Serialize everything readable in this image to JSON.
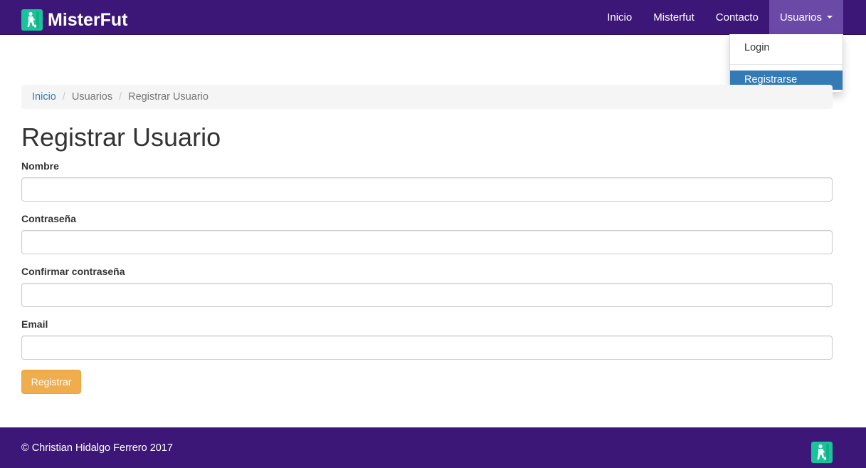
{
  "colors": {
    "brand": "#3d1778",
    "logo_accent": "#18c59a",
    "link": "#337ab7",
    "warning_button": "#f0ad4e"
  },
  "navbar": {
    "brand_name": "MisterFut",
    "brand_icon": "player-logo-icon",
    "items": [
      {
        "label": "Inicio"
      },
      {
        "label": "Misterfut"
      },
      {
        "label": "Contacto"
      },
      {
        "label": "Usuarios"
      }
    ]
  },
  "dropdown": {
    "items": [
      {
        "label": "Login"
      },
      {
        "label": "Registrarse"
      }
    ],
    "selected": "Registrarse"
  },
  "breadcrumb": {
    "items": [
      "Inicio",
      "Usuarios",
      "Registrar Usuario"
    ]
  },
  "page": {
    "title": "Registrar Usuario"
  },
  "form": {
    "fields": [
      {
        "label": "Nombre",
        "value": ""
      },
      {
        "label": "Contraseña",
        "value": ""
      },
      {
        "label": "Confirmar contraseña",
        "value": ""
      },
      {
        "label": "Email",
        "value": ""
      }
    ],
    "submit_label": "Registrar"
  },
  "footer": {
    "copyright": "© Christian Hidalgo Ferrero 2017"
  }
}
